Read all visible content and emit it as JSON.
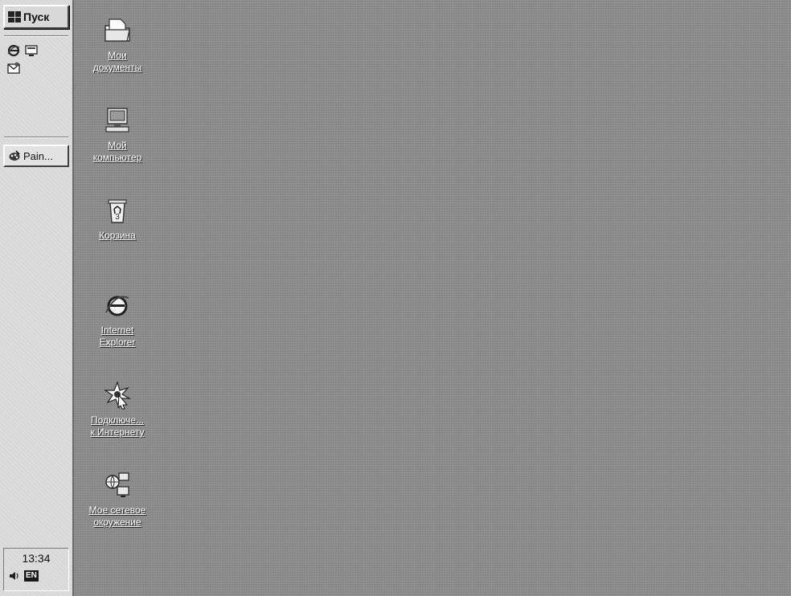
{
  "taskbar": {
    "start_label": "Пуск",
    "task_label": "Pain...",
    "clock": "13:34",
    "lang": "EN",
    "quicklaunch_icons": [
      "ie-icon",
      "show-desktop-icon",
      "outlook-icon"
    ]
  },
  "desktop": {
    "icons": [
      {
        "line1": "Мои",
        "line2": "документы",
        "icon": "my-documents-icon"
      },
      {
        "line1": "Мой",
        "line2": "компьютер",
        "icon": "my-computer-icon"
      },
      {
        "line1": "Корзина",
        "line2": "",
        "icon": "recycle-bin-icon"
      },
      {
        "line1": "Internet",
        "line2": "Explorer",
        "icon": "internet-explorer-icon"
      },
      {
        "line1": "Подключе...",
        "line2": "к Интернету",
        "icon": "connect-to-internet-icon"
      },
      {
        "line1": "Мое сетевое",
        "line2": "окружение",
        "icon": "network-neighborhood-icon"
      }
    ]
  },
  "colors": {
    "desktop": "#8e8e8e",
    "taskbar": "#dcdcdc"
  }
}
